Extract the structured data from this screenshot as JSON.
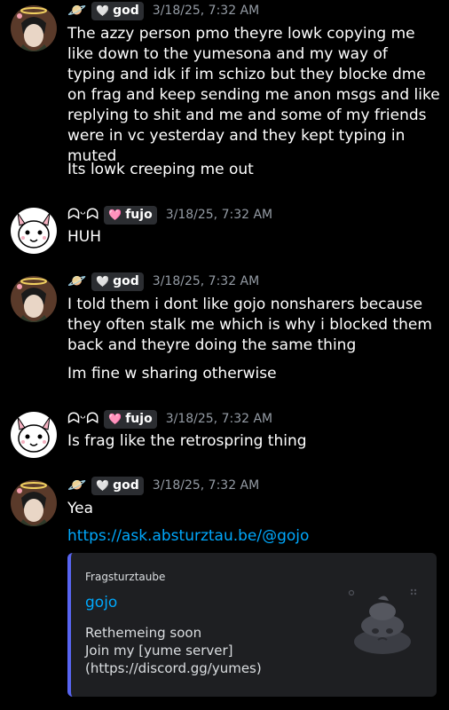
{
  "messages": [
    {
      "author_badge": "🪐",
      "role_heart": "🤍",
      "role": "god",
      "timestamp": "3/18/25, 7:32 AM",
      "lines": [
        "The azzy person pmo theyre lowk copying me like down to the yumesona and my way of typing and idk if im schizo but they blocke dme on frag and keep sending me anon msgs and like replying to shit and me and some of my friends were in vc yesterday and they kept typing in muted",
        "Its lowk creeping me out"
      ]
    },
    {
      "author_badge": "ᗣᵕᗣ",
      "role_heart": "🩷",
      "role": "fujo",
      "timestamp": "3/18/25, 7:32 AM",
      "lines": [
        "HUH"
      ]
    },
    {
      "author_badge": "🪐",
      "role_heart": "🤍",
      "role": "god",
      "timestamp": "3/18/25, 7:32 AM",
      "lines": [
        "I told them i dont like gojo nonsharers because they often stalk me which is why i blocked them back and theyre doing the same thing",
        "Im fine w sharing otherwise"
      ]
    },
    {
      "author_badge": "ᗣᵕᗣ",
      "role_heart": "🩷",
      "role": "fujo",
      "timestamp": "3/18/25, 7:32 AM",
      "lines": [
        "Is frag like the retrospring thing"
      ]
    },
    {
      "author_badge": "🪐",
      "role_heart": "🤍",
      "role": "god",
      "timestamp": "3/18/25, 7:32 AM",
      "lines": [
        "Yea"
      ],
      "link": "https://ask.absturztau.be/@gojo",
      "embed": {
        "provider": "Fragsturztaube",
        "title": "gojo",
        "description_1": "Rethemeing soon",
        "description_2": "Join my [yume server](https://discord.gg/yumes)"
      }
    }
  ],
  "colors": {
    "background": "#000000",
    "text": "#ffffff",
    "timestamp": "#949ba4",
    "link": "#00a8fc",
    "embed_bg": "#1e1f22",
    "embed_border": "#5865f2"
  }
}
